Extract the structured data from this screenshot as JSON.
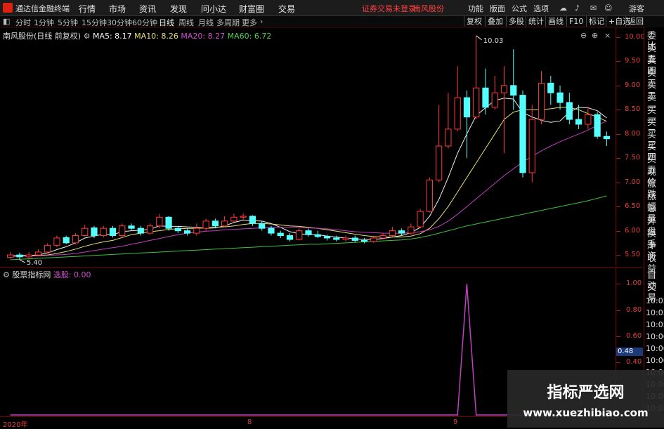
{
  "app": {
    "title": "通达信金融终端",
    "menus": [
      "行情",
      "市场",
      "资讯",
      "发现",
      "问小达",
      "财富圈",
      "交易"
    ],
    "warning": "证券交易未登录",
    "stock": "南风股份",
    "right_menus": [
      "功能",
      "版面",
      "公式",
      "选项"
    ],
    "guest": "游客"
  },
  "periods": {
    "items": [
      "分时",
      "1分钟",
      "5分钟",
      "15分钟",
      "30分钟",
      "60分钟",
      "日线",
      "周线",
      "月线",
      "多周期",
      "更多"
    ],
    "active": "日线"
  },
  "toolbar": [
    "复权",
    "叠加",
    "多股",
    "统计",
    "画线",
    "F10",
    "标记",
    "+自选",
    "返回"
  ],
  "main_info": {
    "name": "南风股份(日线 前复权)",
    "ma5": "MA5: 8.17",
    "ma10": "MA10: 8.26",
    "ma20": "MA20: 8.27",
    "ma60": "MA60: 6.72"
  },
  "sub_info": {
    "name": "股票指标网",
    "value_label": "选股: 0.00"
  },
  "right_panel": {
    "labels": [
      "委比",
      "卖五",
      "卖四",
      "卖三",
      "卖二",
      "卖一",
      "买一",
      "买二",
      "买三",
      "买四",
      "买五",
      "现价",
      "涨跌",
      "涨幅",
      "总量",
      "外盘",
      "换手",
      "净资",
      "收益"
    ],
    "lower": [
      "自动",
      "交易"
    ],
    "times": [
      "10:05",
      "10:05",
      "10:05",
      "10:06",
      "10:06",
      "10:06",
      "10:06",
      "10:06",
      "10:06",
      "10:07"
    ]
  },
  "scales": {
    "main": [
      "10.00",
      "9.50",
      "9.00",
      "8.50",
      "8.00",
      "7.50",
      "7.00",
      "6.50",
      "6.00",
      "5.50"
    ],
    "sub": [
      "1.00",
      "0.80",
      "0.60",
      "0.40"
    ],
    "sub_marker": "0.48"
  },
  "x_axis": [
    "2020年",
    "8",
    "9"
  ],
  "annotations": {
    "high": "10.03",
    "low": "5.40"
  },
  "watermark": {
    "cn": "指标严选网",
    "url": "www.xuezhibiao.com"
  },
  "chart_data": [
    {
      "type": "candlestick",
      "title": "南风股份(日线 前复权)",
      "ylim": [
        5.4,
        10.1
      ],
      "y_ticks": [
        5.5,
        6.0,
        6.5,
        7.0,
        7.5,
        8.0,
        8.5,
        9.0,
        9.5,
        10.0
      ],
      "candles": [
        [
          5.45,
          5.5,
          5.56,
          5.42
        ],
        [
          5.5,
          5.46,
          5.55,
          5.4
        ],
        [
          5.46,
          5.5,
          5.56,
          5.43
        ],
        [
          5.5,
          5.56,
          5.62,
          5.48
        ],
        [
          5.56,
          5.7,
          5.74,
          5.53
        ],
        [
          5.7,
          5.85,
          5.9,
          5.66
        ],
        [
          5.86,
          5.75,
          5.9,
          5.72
        ],
        [
          5.75,
          5.9,
          5.95,
          5.72
        ],
        [
          5.9,
          6.05,
          6.12,
          5.88
        ],
        [
          6.06,
          5.9,
          6.1,
          5.85
        ],
        [
          5.9,
          6.05,
          6.1,
          5.86
        ],
        [
          6.05,
          5.9,
          6.1,
          5.86
        ],
        [
          5.9,
          6.1,
          6.15,
          5.86
        ],
        [
          6.1,
          6.05,
          6.15,
          6.0
        ],
        [
          6.05,
          5.95,
          6.1,
          5.9
        ],
        [
          5.95,
          6.1,
          6.15,
          5.92
        ],
        [
          6.1,
          6.28,
          6.35,
          6.05
        ],
        [
          6.28,
          6.05,
          6.3,
          6.0
        ],
        [
          6.05,
          6.0,
          6.1,
          5.95
        ],
        [
          6.0,
          5.95,
          6.05,
          5.9
        ],
        [
          5.95,
          6.05,
          6.15,
          5.9
        ],
        [
          6.05,
          6.2,
          6.25,
          6.0
        ],
        [
          6.2,
          6.1,
          6.25,
          6.05
        ],
        [
          6.1,
          6.2,
          6.3,
          6.08
        ],
        [
          6.2,
          6.28,
          6.35,
          6.18
        ],
        [
          6.28,
          6.3,
          6.36,
          6.22
        ],
        [
          6.3,
          6.15,
          6.32,
          6.1
        ],
        [
          6.15,
          6.05,
          6.2,
          6.0
        ],
        [
          6.05,
          5.95,
          6.1,
          5.9
        ],
        [
          5.95,
          5.9,
          6.0,
          5.85
        ],
        [
          5.9,
          5.82,
          5.95,
          5.78
        ],
        [
          5.82,
          6.0,
          6.05,
          5.8
        ],
        [
          6.0,
          5.92,
          6.05,
          5.88
        ],
        [
          5.92,
          5.88,
          6.0,
          5.85
        ],
        [
          5.88,
          5.85,
          5.92,
          5.8
        ],
        [
          5.85,
          5.82,
          5.9,
          5.78
        ],
        [
          5.82,
          5.85,
          5.9,
          5.78
        ],
        [
          5.85,
          5.8,
          5.9,
          5.76
        ],
        [
          5.8,
          5.78,
          5.85,
          5.74
        ],
        [
          5.78,
          5.85,
          5.9,
          5.75
        ],
        [
          5.85,
          5.9,
          5.95,
          5.82
        ],
        [
          5.9,
          6.0,
          6.08,
          5.88
        ],
        [
          6.0,
          5.95,
          6.05,
          5.9
        ],
        [
          5.95,
          6.08,
          6.15,
          5.92
        ],
        [
          6.08,
          6.4,
          6.45,
          6.05
        ],
        [
          6.4,
          7.05,
          7.1,
          6.38
        ],
        [
          7.05,
          7.75,
          8.6,
          7.0
        ],
        [
          7.75,
          8.1,
          8.85,
          7.7
        ],
        [
          8.1,
          8.75,
          9.4,
          8.05
        ],
        [
          8.75,
          8.35,
          8.9,
          7.5
        ],
        [
          8.35,
          8.95,
          10.03,
          8.3
        ],
        [
          8.95,
          8.55,
          9.35,
          8.4
        ],
        [
          8.55,
          8.85,
          9.2,
          8.5
        ],
        [
          8.85,
          9.0,
          9.4,
          7.6
        ],
        [
          9.0,
          8.8,
          9.75,
          8.5
        ],
        [
          8.8,
          7.2,
          8.9,
          7.1
        ],
        [
          7.2,
          8.3,
          8.6,
          7.0
        ],
        [
          8.3,
          9.05,
          9.3,
          8.2
        ],
        [
          9.05,
          8.85,
          9.2,
          8.6
        ],
        [
          8.85,
          8.65,
          9.0,
          8.5
        ],
        [
          8.65,
          8.3,
          8.85,
          8.2
        ],
        [
          8.3,
          8.2,
          8.6,
          8.1
        ],
        [
          8.2,
          8.4,
          8.55,
          8.1
        ],
        [
          8.4,
          7.95,
          8.45,
          7.9
        ],
        [
          7.95,
          7.9,
          8.05,
          7.75
        ]
      ],
      "series": [
        {
          "name": "MA5",
          "color": "#f0f0f0",
          "values": [
            5.48,
            5.49,
            5.49,
            5.5,
            5.54,
            5.61,
            5.67,
            5.75,
            5.85,
            5.89,
            5.93,
            5.92,
            5.98,
            6.0,
            6.01,
            6.03,
            6.1,
            6.09,
            6.09,
            6.08,
            6.07,
            6.05,
            6.06,
            6.1,
            6.17,
            6.22,
            6.21,
            6.2,
            6.15,
            6.07,
            5.98,
            5.94,
            5.92,
            5.92,
            5.89,
            5.87,
            5.85,
            5.83,
            5.82,
            5.82,
            5.84,
            5.87,
            5.9,
            5.96,
            6.07,
            6.3,
            6.65,
            7.1,
            7.6,
            8.0,
            8.38,
            8.54,
            8.69,
            8.74,
            8.72,
            8.44,
            8.35,
            8.28,
            8.24,
            8.27,
            8.45,
            8.55,
            8.54,
            8.48,
            8.33
          ]
        },
        {
          "name": "MA10",
          "color": "#e8e070",
          "values": [
            5.48,
            5.48,
            5.49,
            5.49,
            5.5,
            5.53,
            5.57,
            5.62,
            5.68,
            5.73,
            5.77,
            5.8,
            5.86,
            5.92,
            5.95,
            5.98,
            6.0,
            6.03,
            6.04,
            6.05,
            6.05,
            6.06,
            6.07,
            6.08,
            6.1,
            6.13,
            6.15,
            6.15,
            6.14,
            6.12,
            6.1,
            6.09,
            6.07,
            6.05,
            6.02,
            5.99,
            5.96,
            5.93,
            5.9,
            5.88,
            5.87,
            5.87,
            5.87,
            5.89,
            5.94,
            6.05,
            6.25,
            6.5,
            6.8,
            7.1,
            7.4,
            7.7,
            8.0,
            8.3,
            8.45,
            8.5,
            8.5,
            8.5,
            8.52,
            8.55,
            8.55,
            8.5,
            8.42,
            8.35,
            8.26
          ]
        },
        {
          "name": "MA20",
          "color": "#c040c0",
          "values": [
            5.47,
            5.47,
            5.48,
            5.48,
            5.49,
            5.5,
            5.51,
            5.53,
            5.56,
            5.59,
            5.62,
            5.65,
            5.68,
            5.72,
            5.76,
            5.8,
            5.84,
            5.88,
            5.92,
            5.95,
            5.97,
            5.99,
            6.0,
            6.02,
            6.03,
            6.04,
            6.05,
            6.06,
            6.07,
            6.07,
            6.07,
            6.07,
            6.06,
            6.05,
            6.04,
            6.02,
            6.0,
            5.98,
            5.97,
            5.96,
            5.95,
            5.95,
            5.95,
            5.96,
            5.98,
            6.02,
            6.09,
            6.2,
            6.34,
            6.5,
            6.66,
            6.82,
            6.98,
            7.14,
            7.28,
            7.42,
            7.54,
            7.65,
            7.75,
            7.84,
            7.92,
            8.0,
            8.08,
            8.18,
            8.27
          ]
        },
        {
          "name": "MA60",
          "color": "#40c040",
          "values": [
            5.4,
            5.41,
            5.42,
            5.43,
            5.44,
            5.45,
            5.46,
            5.47,
            5.48,
            5.49,
            5.5,
            5.51,
            5.52,
            5.53,
            5.54,
            5.55,
            5.56,
            5.57,
            5.58,
            5.59,
            5.6,
            5.61,
            5.62,
            5.63,
            5.64,
            5.65,
            5.66,
            5.67,
            5.68,
            5.69,
            5.7,
            5.71,
            5.72,
            5.72,
            5.73,
            5.74,
            5.75,
            5.76,
            5.77,
            5.78,
            5.79,
            5.8,
            5.81,
            5.83,
            5.86,
            5.9,
            5.95,
            6.0,
            6.05,
            6.1,
            6.14,
            6.18,
            6.22,
            6.26,
            6.3,
            6.34,
            6.38,
            6.42,
            6.46,
            6.5,
            6.54,
            6.58,
            6.62,
            6.67,
            6.72
          ]
        }
      ]
    },
    {
      "type": "line",
      "title": "股票指标网",
      "ylim": [
        0,
        1.05
      ],
      "series": [
        {
          "name": "选股",
          "color": "#c040c0",
          "values": [
            0,
            0,
            0,
            0,
            0,
            0,
            0,
            0,
            0,
            0,
            0,
            0,
            0,
            0,
            0,
            0,
            0,
            0,
            0,
            0,
            0,
            0,
            0,
            0,
            0,
            0,
            0,
            0,
            0,
            0,
            0,
            0,
            0,
            0,
            0,
            0,
            0,
            0,
            0,
            0,
            0,
            0,
            0,
            0,
            0,
            0,
            0,
            0,
            0,
            1,
            0,
            0,
            0,
            0,
            0,
            0,
            0,
            0,
            0,
            0,
            0,
            0,
            0,
            0,
            0
          ]
        }
      ]
    }
  ]
}
